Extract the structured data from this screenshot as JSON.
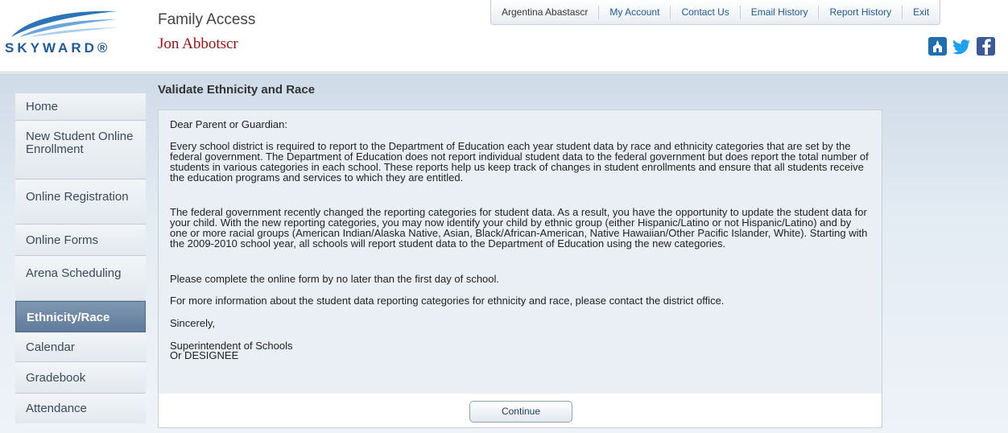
{
  "header": {
    "logo_text": "SKYWARD®",
    "app_title": "Family Access",
    "student_name": "Jon Abbotscr"
  },
  "topnav": {
    "user": "Argentina Abastascr",
    "my_account": "My Account",
    "contact_us": "Contact Us",
    "email_history": "Email History",
    "report_history": "Report History",
    "exit": "Exit"
  },
  "social": {
    "school_icon": "school-icon",
    "twitter_icon": "twitter-icon",
    "facebook_icon": "facebook-icon"
  },
  "sidebar": {
    "items": [
      {
        "label": "Home"
      },
      {
        "label": "New Student Online Enrollment"
      },
      {
        "label": "Online Registration"
      },
      {
        "label": "Online Forms"
      },
      {
        "label": "Arena Scheduling"
      },
      {
        "label": "Ethnicity/Race"
      },
      {
        "label": "Calendar"
      },
      {
        "label": "Gradebook"
      },
      {
        "label": "Attendance"
      }
    ],
    "active": "Ethnicity/Race"
  },
  "main": {
    "title": "Validate Ethnicity and Race",
    "greeting": "Dear Parent or Guardian:",
    "para1": "Every school district is required to report to the Department of Education each year student data by race and ethnicity categories that are set by the federal government. The Department of Education does not report individual student data to the federal government but does report the total number of students in various categories in each school. These reports help us keep track of changes in student enrollments and ensure that all students receive the education programs and services to which they are entitled.",
    "para2": "The federal government recently changed the reporting categories for student data. As a result, you have the opportunity to update the student data for your child. With the new reporting categories, you may now identify your child by ethnic group (either Hispanic/Latino or not Hispanic/Latino) and by one or more racial groups (American Indian/Alaska Native, Asian, Black/African-American, Native Hawaiian/Other Pacific Islander, White). Starting with the 2009-2010 school year, all schools will report student data to the Department of Education using the new categories.",
    "para3": "Please complete the online form by no later than the first day of school.",
    "para4": "For more information about the student data reporting categories for ethnicity and race, please contact the district office.",
    "closing": "Sincerely,",
    "signature_line1": "Superintendent of Schools",
    "signature_line2": "Or DESIGNEE",
    "continue_label": "Continue"
  },
  "colors": {
    "brand_blue": "#1d5a99",
    "student_name_red": "#a01010",
    "active_nav": "#6a86a5",
    "panel_bg": "#e9eff5"
  }
}
